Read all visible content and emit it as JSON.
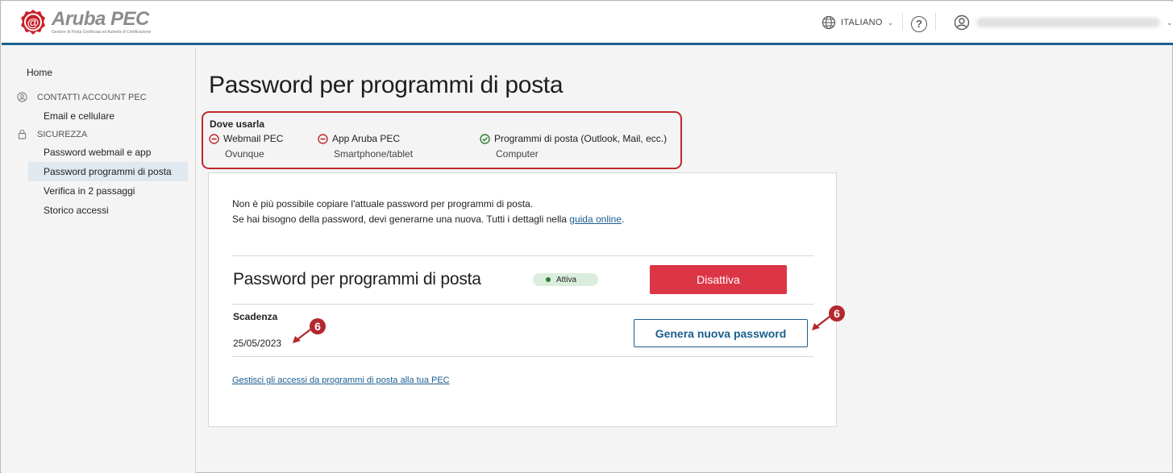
{
  "header": {
    "logo_text": "Aruba PEC",
    "logo_tagline": "Gestore di Posta Certificata ed Autorità di Certificazione",
    "language": "ITALIANO",
    "help_glyph": "?"
  },
  "sidebar": {
    "home": "Home",
    "groups": [
      {
        "label": "CONTATTI ACCOUNT PEC",
        "icon": "user-circle-icon",
        "items": [
          {
            "label": "Email e cellulare"
          }
        ]
      },
      {
        "label": "SICUREZZA",
        "icon": "lock-icon",
        "items": [
          {
            "label": "Password webmail e app"
          },
          {
            "label": "Password programmi di posta",
            "active": true
          },
          {
            "label": "Verifica in 2 passaggi"
          },
          {
            "label": "Storico accessi"
          }
        ]
      }
    ]
  },
  "main": {
    "title": "Password per programmi di posta",
    "where": {
      "heading": "Dove usarla",
      "items": [
        {
          "name": "Webmail PEC",
          "sub": "Ovunque",
          "status": "not-allowed",
          "icon": "minus-circle-icon"
        },
        {
          "name": "App Aruba PEC",
          "sub": "Smartphone/tablet",
          "status": "not-allowed",
          "icon": "minus-circle-icon"
        },
        {
          "name": "Programmi di posta (Outlook, Mail, ecc.)",
          "sub": "Computer",
          "status": "allowed",
          "icon": "check-circle-icon"
        }
      ]
    },
    "card": {
      "msg_line1": "Non è più possibile copiare l'attuale password per programmi di posta.",
      "msg_line2_before": "Se hai bisogno della password, devi generarne una nuova. Tutti i dettagli nella ",
      "msg_link": "guida online",
      "msg_line2_after": ".",
      "pw_title": "Password per programmi di posta",
      "status_badge": "Attiva",
      "deactivate_button": "Disattiva",
      "expiry_label": "Scadenza",
      "expiry_value": "25/05/2023",
      "generate_button": "Genera nuova password",
      "manage_link": "Gestisci gli accessi da programmi di posta alla tua PEC"
    },
    "annotations": [
      {
        "label": "6"
      },
      {
        "label": "6"
      }
    ]
  },
  "colors": {
    "brand_blue": "#1b5e8f",
    "danger_red": "#dc3545",
    "highlight_border": "#c0272d",
    "success_green": "#2e7d32",
    "annotation_red": "#b3282e"
  }
}
